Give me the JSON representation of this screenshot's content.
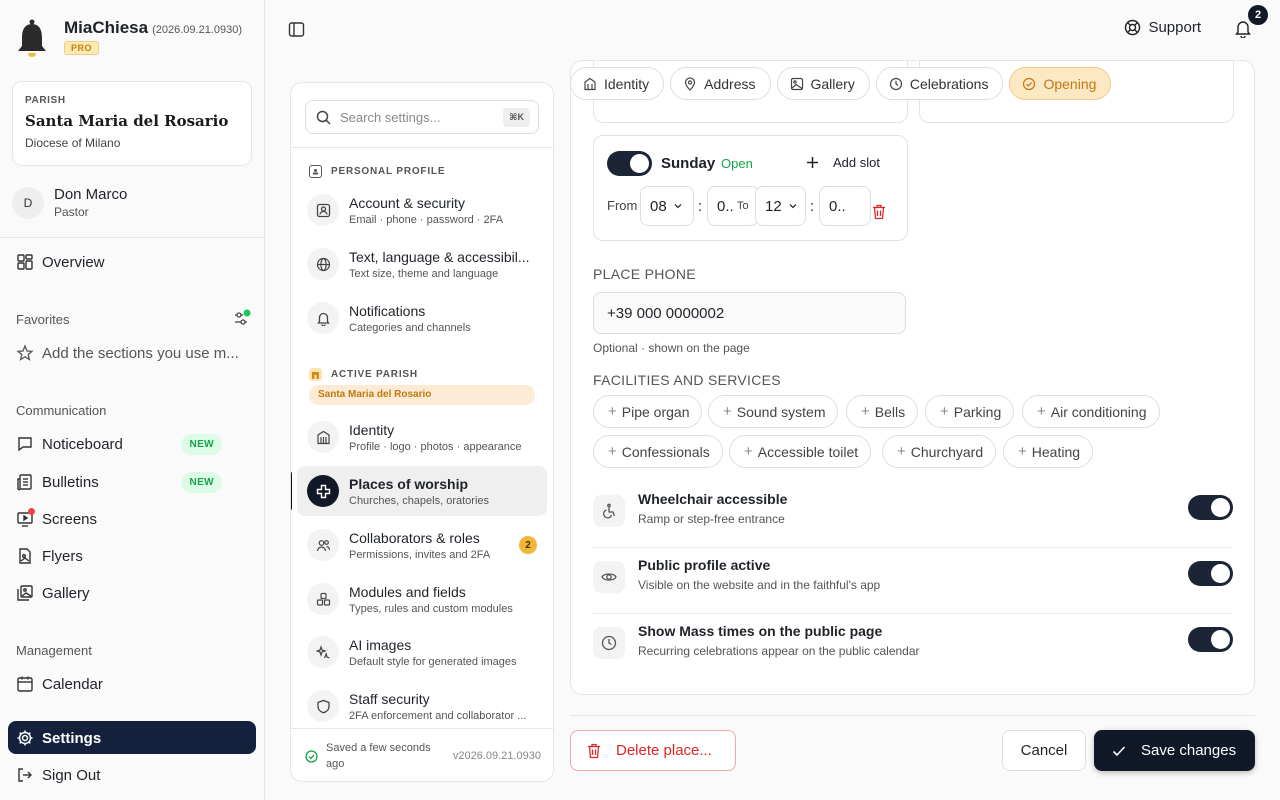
{
  "app": {
    "name": "MiaChiesa",
    "version": "(2026.09.21.0930)",
    "tier": "PRO"
  },
  "parish": {
    "label": "PARISH",
    "name": "Santa Maria del Rosario",
    "diocese": "Diocese of Milano"
  },
  "user": {
    "initial": "D",
    "name": "Don Marco",
    "role": "Pastor"
  },
  "sidebar": {
    "overview": "Overview",
    "favorites_title": "Favorites",
    "favorites_hint": "Add the sections you use m...",
    "communication_title": "Communication",
    "communication": [
      {
        "label": "Noticeboard",
        "badge": "NEW"
      },
      {
        "label": "Bulletins",
        "badge": "NEW"
      },
      {
        "label": "Screens"
      },
      {
        "label": "Flyers"
      },
      {
        "label": "Gallery"
      }
    ],
    "management_title": "Management",
    "calendar": "Calendar",
    "settings": "Settings",
    "signout": "Sign Out"
  },
  "topbar": {
    "support": "Support",
    "notifications_count": "2"
  },
  "settings_nav": {
    "search_placeholder": "Search settings...",
    "shortcut": "⌘K",
    "personal_title": "PERSONAL PROFILE",
    "personal": [
      {
        "title": "Account & security",
        "sub": "Email · phone · password · 2FA"
      },
      {
        "title": "Text, language & accessibil...",
        "sub": "Text size, theme and language"
      },
      {
        "title": "Notifications",
        "sub": "Categories and channels"
      }
    ],
    "parish_title": "ACTIVE PARISH",
    "parish_chip": "Santa Maria del Rosario",
    "parish_items": [
      {
        "title": "Identity",
        "sub": "Profile · logo · photos · appearance"
      },
      {
        "title": "Places of worship",
        "sub": "Churches, chapels, oratories"
      },
      {
        "title": "Collaborators & roles",
        "sub": "Permissions, invites and 2FA",
        "badge": "2"
      },
      {
        "title": "Modules and fields",
        "sub": "Types, rules and custom modules"
      },
      {
        "title": "AI images",
        "sub": "Default style for generated images"
      },
      {
        "title": "Staff security",
        "sub": "2FA enforcement and collaborator ..."
      }
    ],
    "saved": "Saved a few seconds ago",
    "version": "v2026.09.21.0930"
  },
  "tabs": [
    "Identity",
    "Address",
    "Gallery",
    "Celebrations",
    "Opening"
  ],
  "opening": {
    "day": "Sunday",
    "status": "Open",
    "add_slot": "Add slot",
    "from_label": "From",
    "to_label": "To",
    "from_hour": "08",
    "from_min": "0..",
    "to_hour": "12",
    "to_min": "0.."
  },
  "phone": {
    "label": "PLACE PHONE",
    "value": "+39 000 0000002",
    "hint": "Optional · shown on the page"
  },
  "facilities": {
    "label": "FACILITIES AND SERVICES",
    "items": [
      "Pipe organ",
      "Sound system",
      "Bells",
      "Parking",
      "Air conditioning",
      "Confessionals",
      "Accessible toilet",
      "Churchyard",
      "Heating"
    ]
  },
  "toggles": [
    {
      "title": "Wheelchair accessible",
      "sub": "Ramp or step-free entrance",
      "on": true
    },
    {
      "title": "Public profile active",
      "sub": "Visible on the website and in the faithful's app",
      "on": true
    },
    {
      "title": "Show Mass times on the public page",
      "sub": "Recurring celebrations appear on the public calendar",
      "on": true
    }
  ],
  "actions": {
    "delete": "Delete place...",
    "cancel": "Cancel",
    "save": "Save changes"
  },
  "colors": {
    "accent": "#111827",
    "amber": "#c2780f",
    "danger": "#dc2626",
    "success": "#16a34a"
  }
}
